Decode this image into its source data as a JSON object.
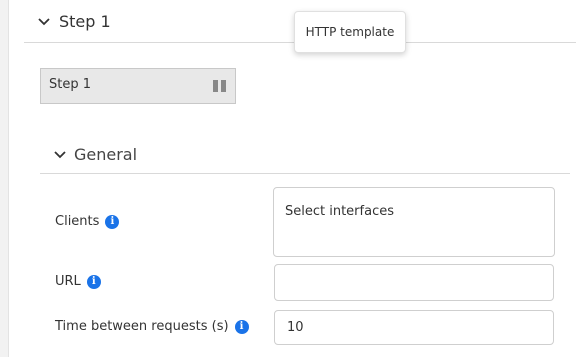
{
  "step": {
    "title": "Step 1",
    "chip_label": "Step 1"
  },
  "tooltip": {
    "text": "HTTP template"
  },
  "general": {
    "title": "General"
  },
  "fields": {
    "clients": {
      "label": "Clients",
      "value": "Select interfaces"
    },
    "url": {
      "label": "URL",
      "value": ""
    },
    "time_between_requests": {
      "label": "Time between requests (s)",
      "value": "10"
    }
  },
  "icons": {
    "collapse": "chevron-down-icon",
    "info": "info-icon",
    "drag": "drag-handle-icon"
  },
  "colors": {
    "info_blue": "#1a73e8",
    "chip_background": "#e8e8e8"
  }
}
